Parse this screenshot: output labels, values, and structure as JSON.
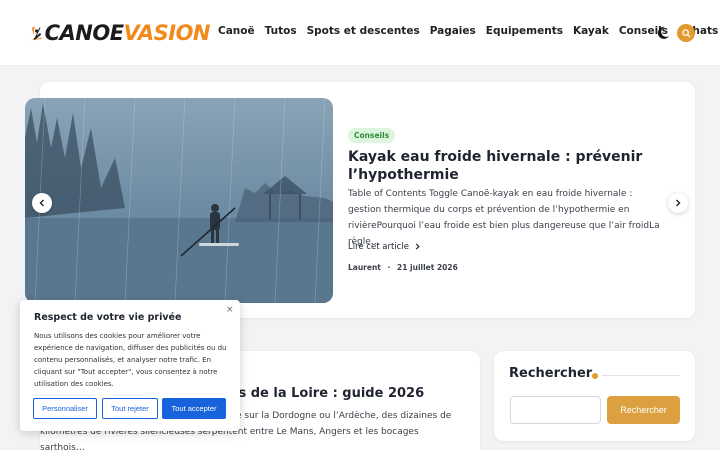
{
  "logo": {
    "text_main": "CANOE",
    "text_accent": "VASION"
  },
  "nav": [
    "Canoë",
    "Tutos",
    "Spots et descentes",
    "Pagaies",
    "Equipements",
    "Kayak",
    "Conseils",
    "Achats"
  ],
  "icons": {
    "theme": "moon-icon",
    "search": "search-icon",
    "prev": "chevron-left-icon",
    "next": "chevron-right-icon",
    "readmore": "chevron-right-icon",
    "close": "close-icon"
  },
  "colors": {
    "accent": "#e29a2e",
    "tag_bg": "#ddf5dc",
    "tag_fg": "#2e8b3a",
    "cookie_blue": "#1863dc"
  },
  "hero": {
    "tag": "Conseils",
    "title": "Kayak eau froide hivernale : prévenir l’hypothermie",
    "excerpt": "Table of Contents Toggle Canoë-kayak en eau froide hivernale : gestion thermique du corps et prévention de l’hypothermie en rivièrePourquoi l’eau froide est bien plus dangereuse que l’air froidLa règle…",
    "readmore": "Lire cet article",
    "author": "Laurent",
    "separator": "·",
    "date": "21 juillet 2026"
  },
  "card2": {
    "title": "ys de la Loire : guide 2026",
    "text_line1": "aie sur la Dordogne ou l’Ardèche, des dizaines de",
    "text_line2": "kilomètres de rivières silencieuses serpentent entre Le Mans, Angers et les bocages sarthois…"
  },
  "sidebar": {
    "title": "Rechercher",
    "button": "Rechercher",
    "placeholder": ""
  },
  "cookie": {
    "title": "Respect de votre vie privée",
    "text": "Nous utilisons des cookies pour améliorer votre expérience de navigation, diffuser des publicités ou du contenu personnalisés, et analyser notre trafic. En cliquant sur \"Tout accepter\", vous consentez à notre utilisation des cookies.",
    "customize": "Personnaliser",
    "reject": "Tout rejeter",
    "accept": "Tout accepter",
    "close": "×"
  }
}
